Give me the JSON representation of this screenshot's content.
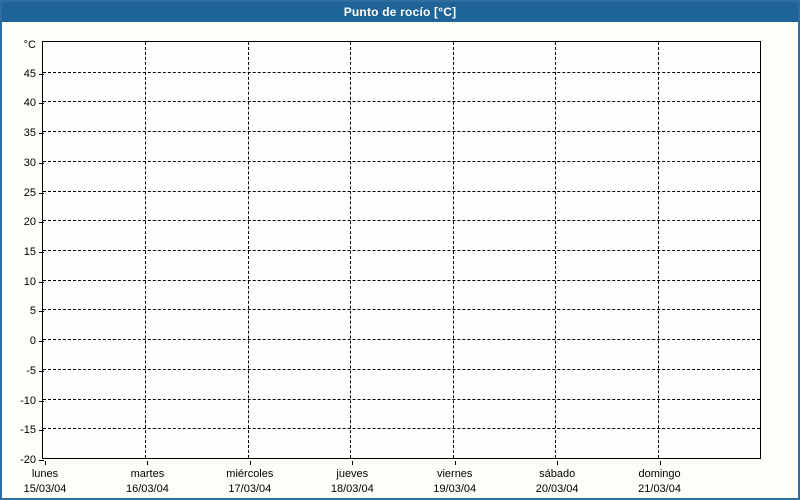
{
  "header": {
    "title": "Punto de rocío [°C]",
    "background": "#1f6498",
    "text_color": "#ffffff"
  },
  "frame": {
    "border_color": "#2e6d9c",
    "background": "#fcfef8"
  },
  "chart_data": {
    "type": "line",
    "title": "Punto de rocío [°C]",
    "unit_label": "°C",
    "ylim": [
      -20,
      50
    ],
    "y_tick_step": 5,
    "y_tick_labels": [
      45,
      40,
      35,
      30,
      25,
      20,
      15,
      10,
      5,
      0,
      -5,
      -10,
      -15,
      -20
    ],
    "grid": "dashed",
    "legend": "none",
    "x_categories": [
      {
        "day": "lunes",
        "date": "15/03/04"
      },
      {
        "day": "martes",
        "date": "16/03/04"
      },
      {
        "day": "miércoles",
        "date": "17/03/04"
      },
      {
        "day": "jueves",
        "date": "18/03/04"
      },
      {
        "day": "viernes",
        "date": "19/03/04"
      },
      {
        "day": "sábado",
        "date": "20/03/04"
      },
      {
        "day": "domingo",
        "date": "21/03/04"
      }
    ],
    "series": []
  }
}
